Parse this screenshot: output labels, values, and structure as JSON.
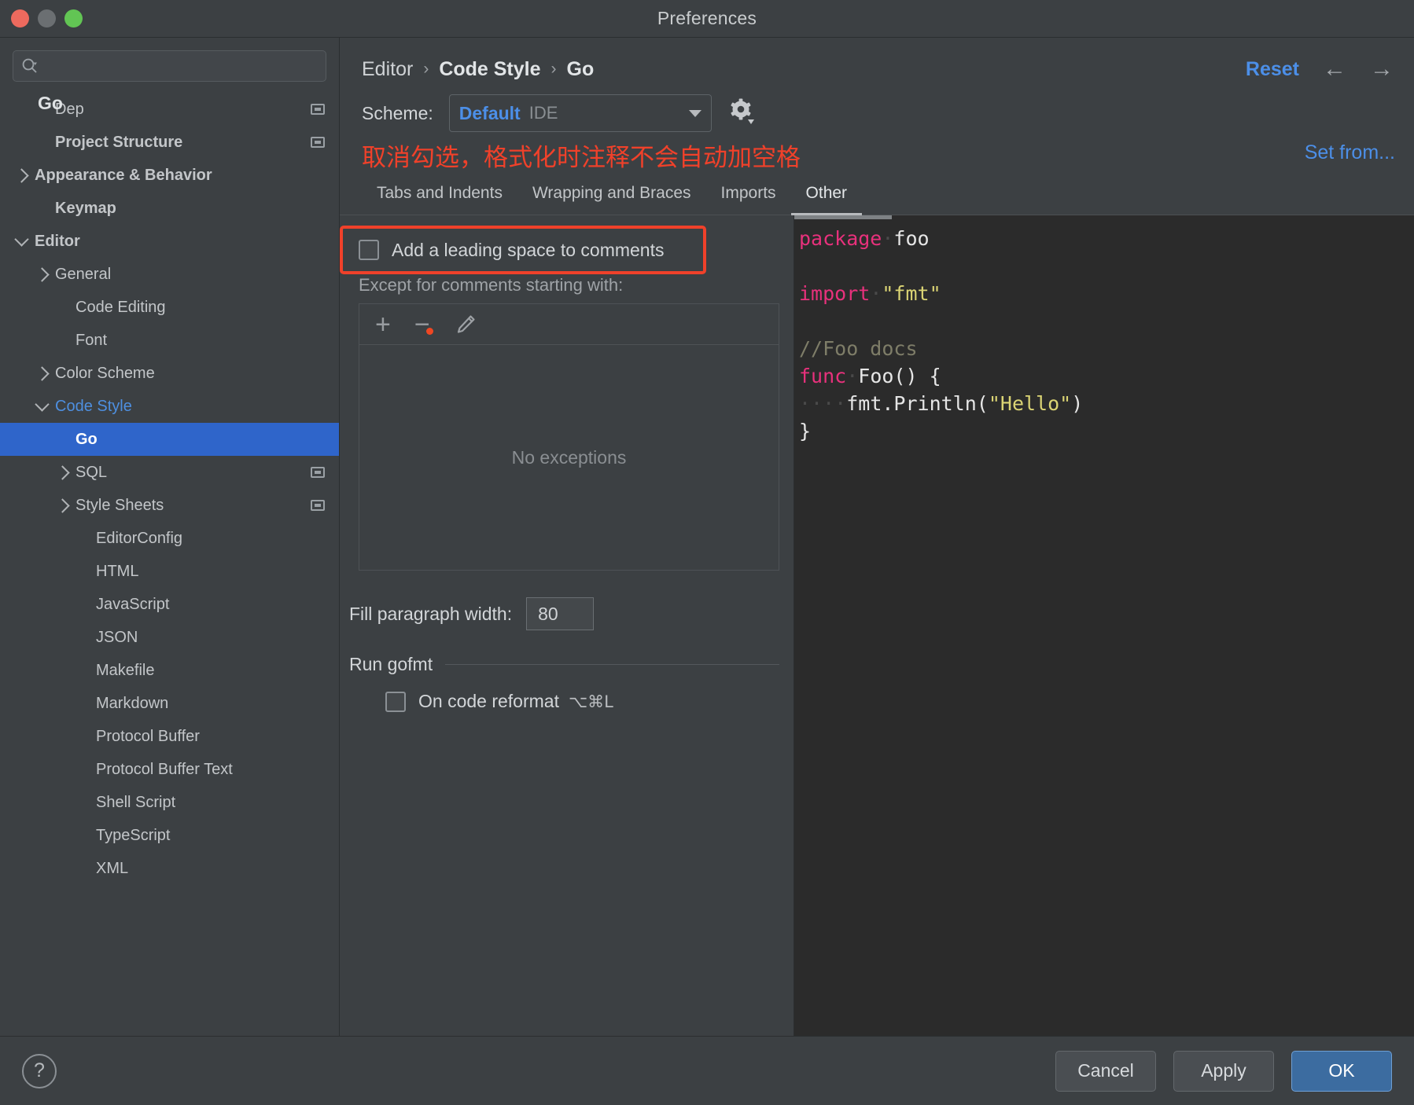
{
  "window": {
    "title": "Preferences",
    "controls": [
      "close-button",
      "minimize-button",
      "zoom-button"
    ]
  },
  "sidebar": {
    "search": {
      "value": "",
      "placeholder": ""
    },
    "floating_header": "Go",
    "items": [
      {
        "label": "Dep",
        "indent": 1,
        "bold": false,
        "arrow": "none",
        "badge": true,
        "selected": false,
        "accent": false
      },
      {
        "label": "Project Structure",
        "indent": 1,
        "bold": true,
        "arrow": "none",
        "badge": true,
        "selected": false,
        "accent": false
      },
      {
        "label": "Appearance & Behavior",
        "indent": 0,
        "bold": true,
        "arrow": "right",
        "badge": false,
        "selected": false,
        "accent": false
      },
      {
        "label": "Keymap",
        "indent": 1,
        "bold": true,
        "arrow": "none",
        "badge": false,
        "selected": false,
        "accent": false
      },
      {
        "label": "Editor",
        "indent": 0,
        "bold": true,
        "arrow": "down",
        "badge": false,
        "selected": false,
        "accent": false
      },
      {
        "label": "General",
        "indent": 1,
        "bold": false,
        "arrow": "right",
        "badge": false,
        "selected": false,
        "accent": false
      },
      {
        "label": "Code Editing",
        "indent": 2,
        "bold": false,
        "arrow": "none",
        "badge": false,
        "selected": false,
        "accent": false
      },
      {
        "label": "Font",
        "indent": 2,
        "bold": false,
        "arrow": "none",
        "badge": false,
        "selected": false,
        "accent": false
      },
      {
        "label": "Color Scheme",
        "indent": 1,
        "bold": false,
        "arrow": "right",
        "badge": false,
        "selected": false,
        "accent": false
      },
      {
        "label": "Code Style",
        "indent": 1,
        "bold": false,
        "arrow": "down",
        "badge": false,
        "selected": false,
        "accent": true
      },
      {
        "label": "Go",
        "indent": 2,
        "bold": true,
        "arrow": "none",
        "badge": false,
        "selected": true,
        "accent": false
      },
      {
        "label": "SQL",
        "indent": 2,
        "bold": false,
        "arrow": "right",
        "badge": true,
        "selected": false,
        "accent": false
      },
      {
        "label": "Style Sheets",
        "indent": 2,
        "bold": false,
        "arrow": "right",
        "badge": true,
        "selected": false,
        "accent": false
      },
      {
        "label": "EditorConfig",
        "indent": 3,
        "bold": false,
        "arrow": "none",
        "badge": false,
        "selected": false,
        "accent": false
      },
      {
        "label": "HTML",
        "indent": 3,
        "bold": false,
        "arrow": "none",
        "badge": false,
        "selected": false,
        "accent": false
      },
      {
        "label": "JavaScript",
        "indent": 3,
        "bold": false,
        "arrow": "none",
        "badge": false,
        "selected": false,
        "accent": false
      },
      {
        "label": "JSON",
        "indent": 3,
        "bold": false,
        "arrow": "none",
        "badge": false,
        "selected": false,
        "accent": false
      },
      {
        "label": "Makefile",
        "indent": 3,
        "bold": false,
        "arrow": "none",
        "badge": false,
        "selected": false,
        "accent": false
      },
      {
        "label": "Markdown",
        "indent": 3,
        "bold": false,
        "arrow": "none",
        "badge": false,
        "selected": false,
        "accent": false
      },
      {
        "label": "Protocol Buffer",
        "indent": 3,
        "bold": false,
        "arrow": "none",
        "badge": false,
        "selected": false,
        "accent": false
      },
      {
        "label": "Protocol Buffer Text",
        "indent": 3,
        "bold": false,
        "arrow": "none",
        "badge": false,
        "selected": false,
        "accent": false
      },
      {
        "label": "Shell Script",
        "indent": 3,
        "bold": false,
        "arrow": "none",
        "badge": false,
        "selected": false,
        "accent": false
      },
      {
        "label": "TypeScript",
        "indent": 3,
        "bold": false,
        "arrow": "none",
        "badge": false,
        "selected": false,
        "accent": false
      },
      {
        "label": "XML",
        "indent": 3,
        "bold": false,
        "arrow": "none",
        "badge": false,
        "selected": false,
        "accent": false
      }
    ]
  },
  "header": {
    "breadcrumb": [
      "Editor",
      "Code Style",
      "Go"
    ],
    "separator": "›",
    "reset_label": "Reset",
    "back_arrow": "←",
    "forward_arrow": "→"
  },
  "scheme": {
    "label": "Scheme:",
    "value": "Default",
    "scope": "IDE",
    "gear_icon": "gear-icon"
  },
  "annotation": {
    "text": "取消勾选，格式化时注释不会自动加空格",
    "color": "#f0412a"
  },
  "set_from": {
    "label": "Set from..."
  },
  "tabs": [
    {
      "label": "Tabs and Indents",
      "active": false
    },
    {
      "label": "Wrapping and Braces",
      "active": false
    },
    {
      "label": "Imports",
      "active": false
    },
    {
      "label": "Other",
      "active": true
    }
  ],
  "settings": {
    "leading_space": {
      "label": "Add a leading space to comments",
      "checked": false,
      "highlighted": true
    },
    "except_label": "Except for comments starting with:",
    "exceptions_toolbar": {
      "add_icon": "plus-icon",
      "remove_icon": "minus-icon",
      "edit_icon": "pencil-icon"
    },
    "exceptions_empty": "No exceptions",
    "fill_paragraph": {
      "label": "Fill paragraph width:",
      "value": "80"
    },
    "run_gofmt": {
      "group_title": "Run gofmt",
      "checkbox_label": "On code reformat",
      "shortcut": "⌥⌘L",
      "checked": false
    }
  },
  "preview": {
    "lines": [
      [
        {
          "t": "package",
          "c": "kw"
        },
        {
          "t": " ",
          "c": "ws"
        },
        {
          "t": "foo",
          "c": "plain"
        }
      ],
      [],
      [
        {
          "t": "import",
          "c": "kw"
        },
        {
          "t": " ",
          "c": "ws"
        },
        {
          "t": "\"fmt\"",
          "c": "str"
        }
      ],
      [],
      [
        {
          "t": "//Foo docs",
          "c": "cmt"
        }
      ],
      [
        {
          "t": "func",
          "c": "kw"
        },
        {
          "t": " ",
          "c": "ws"
        },
        {
          "t": "Foo() {",
          "c": "plain"
        }
      ],
      [
        {
          "t": "    ",
          "c": "ws"
        },
        {
          "t": "fmt.Println(",
          "c": "plain"
        },
        {
          "t": "\"Hello\"",
          "c": "str"
        },
        {
          "t": ")",
          "c": "plain"
        }
      ],
      [
        {
          "t": "}",
          "c": "plain"
        }
      ]
    ]
  },
  "footer": {
    "help_label": "?",
    "cancel_label": "Cancel",
    "apply_label": "Apply",
    "ok_label": "OK"
  },
  "colors": {
    "accent_blue": "#4c8fe8",
    "selection_blue": "#2f65ca",
    "annotation_red": "#f0412a",
    "window_bg": "#3c4043",
    "editor_bg": "#2b2b2b"
  }
}
